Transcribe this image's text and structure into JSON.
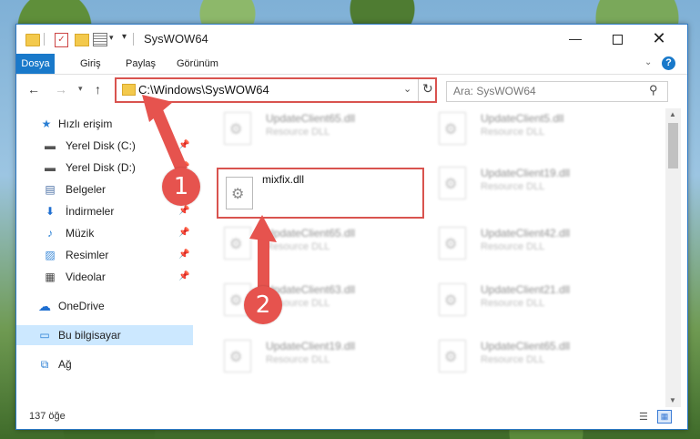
{
  "window": {
    "title": "SysWOW64",
    "qa_check_glyph": "✓",
    "qa_dropdown_glyph": "▾",
    "qa_customize_glyph": "▾",
    "min_glyph": "—",
    "close_glyph": "✕"
  },
  "ribbon": {
    "tabs": [
      {
        "label": "Dosya"
      },
      {
        "label": "Giriş"
      },
      {
        "label": "Paylaş"
      },
      {
        "label": "Görünüm"
      }
    ],
    "collapse_glyph": "⌄",
    "help_glyph": "?"
  },
  "toolbar": {
    "back_glyph": "←",
    "forward_glyph": "→",
    "recent_glyph": "▾",
    "up_glyph": "↑"
  },
  "address": {
    "path": "C:\\Windows\\SysWOW64",
    "dropdown_glyph": "⌄",
    "refresh_glyph": "↻"
  },
  "search": {
    "placeholder": "Ara: SysWOW64",
    "icon_glyph": "⚲"
  },
  "nav_pane": {
    "quick_access": {
      "label": "Hızlı erişim",
      "icon": "star-icon",
      "glyph": "★"
    },
    "items": [
      {
        "label": "Yerel Disk (C:)",
        "icon": "drive-icon",
        "glyph": "▬",
        "pinned": true
      },
      {
        "label": "Yerel Disk (D:)",
        "icon": "drive-icon",
        "glyph": "▬",
        "pinned": true
      },
      {
        "label": "Belgeler",
        "icon": "documents-icon",
        "glyph": "▤",
        "pinned": true
      },
      {
        "label": "İndirmeler",
        "icon": "downloads-icon",
        "glyph": "⬇",
        "pinned": true
      },
      {
        "label": "Müzik",
        "icon": "music-icon",
        "glyph": "♪",
        "pinned": true
      },
      {
        "label": "Resimler",
        "icon": "pictures-icon",
        "glyph": "▨",
        "pinned": true
      },
      {
        "label": "Videolar",
        "icon": "videos-icon",
        "glyph": "▦",
        "pinned": true
      }
    ],
    "pin_glyph": "📌",
    "onedrive": {
      "label": "OneDrive",
      "icon": "cloud-icon",
      "glyph": "☁"
    },
    "this_pc": {
      "label": "Bu bilgisayar",
      "icon": "computer-icon",
      "glyph": "▭"
    },
    "network": {
      "label": "Ağ",
      "icon": "network-icon",
      "glyph": "⧉"
    }
  },
  "files": [
    {
      "name": "UpdateClient65.dll",
      "type": "Resource DLL"
    },
    {
      "name": "UpdateClient5.dll",
      "type": "Resource DLL"
    },
    {
      "name": "mixfix.dll",
      "type": ""
    },
    {
      "name": "UpdateClient19.dll",
      "type": "Resource DLL"
    },
    {
      "name": "UpdateClient65.dll",
      "type": "Resource DLL"
    },
    {
      "name": "UpdateClient42.dll",
      "type": "Resource DLL"
    },
    {
      "name": "UpdateClient63.dll",
      "type": "Resource DLL"
    },
    {
      "name": "UpdateClient21.dll",
      "type": "Resource DLL"
    },
    {
      "name": "UpdateClient19.dll",
      "type": "Resource DLL"
    },
    {
      "name": "UpdateClient65.dll",
      "type": "Resource DLL"
    }
  ],
  "status": {
    "count": "137 öğe",
    "details_glyph": "☰",
    "tiles_glyph": "▦"
  },
  "scrollbar": {
    "up_glyph": "▲",
    "down_glyph": "▼"
  },
  "callouts": {
    "one": "1",
    "two": "2"
  },
  "colors": {
    "accent": "#1979ca",
    "highlight_red": "#d9534f",
    "callout_red": "#e6534e",
    "selected_nav": "#cce8ff"
  }
}
